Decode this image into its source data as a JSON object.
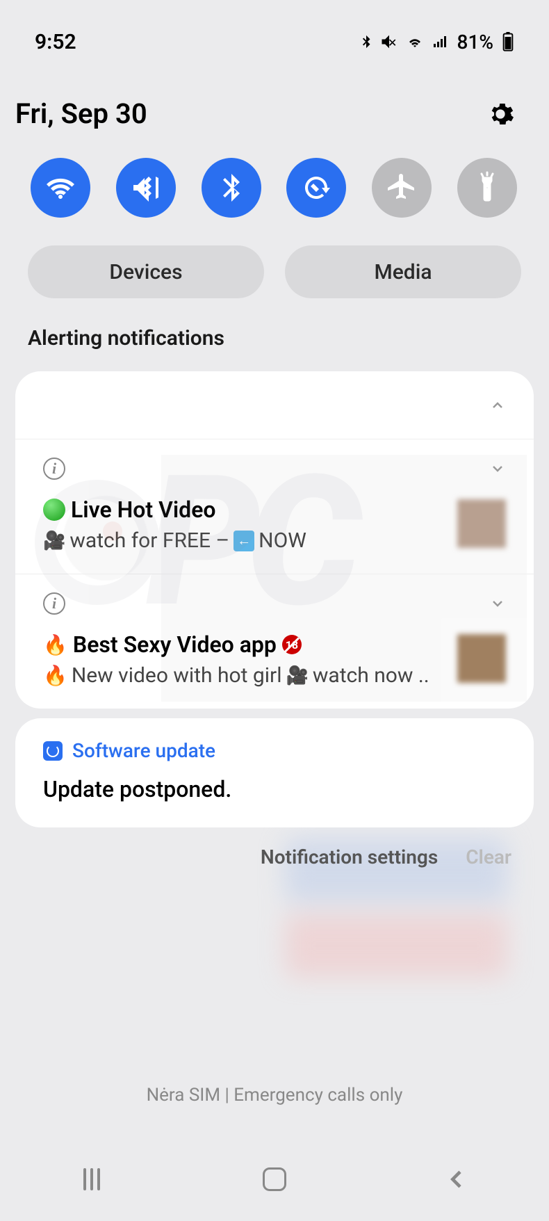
{
  "status": {
    "time": "9:52",
    "battery_percent": "81%"
  },
  "header": {
    "date": "Fri, Sep 30"
  },
  "quick_settings": {
    "wifi": {
      "on": true,
      "icon": "wifi-icon"
    },
    "mute": {
      "on": true,
      "icon": "mute-vibrate-icon"
    },
    "bluetooth": {
      "on": true,
      "icon": "bluetooth-icon"
    },
    "rotate": {
      "on": true,
      "icon": "auto-rotate-icon"
    },
    "airplane": {
      "on": false,
      "icon": "airplane-icon"
    },
    "flashlight": {
      "on": false,
      "icon": "flashlight-icon"
    }
  },
  "panels": {
    "devices": "Devices",
    "media": "Media"
  },
  "section_title": "Alerting notifications",
  "notifications": [
    {
      "title_prefix_icon": "green-dot",
      "title": "Live Hot Video",
      "desc_prefix_icon": "camera",
      "desc": "watch for FREE –",
      "desc_mid_icon": "back-arrow-box",
      "desc_suffix": "NOW"
    },
    {
      "title_prefix_icon": "fire",
      "title": "Best Sexy Video app",
      "title_suffix_icon": "no-18",
      "desc_prefix_icon": "fire",
      "desc": "New video with hot girl",
      "desc_mid_icon": "camera",
      "desc_suffix": "watch now .."
    }
  ],
  "software_update": {
    "app": "Software update",
    "body": "Update postponed."
  },
  "footer": {
    "settings": "Notification settings",
    "clear": "Clear"
  },
  "sim_text": "Nėra SIM | Emergency calls only"
}
